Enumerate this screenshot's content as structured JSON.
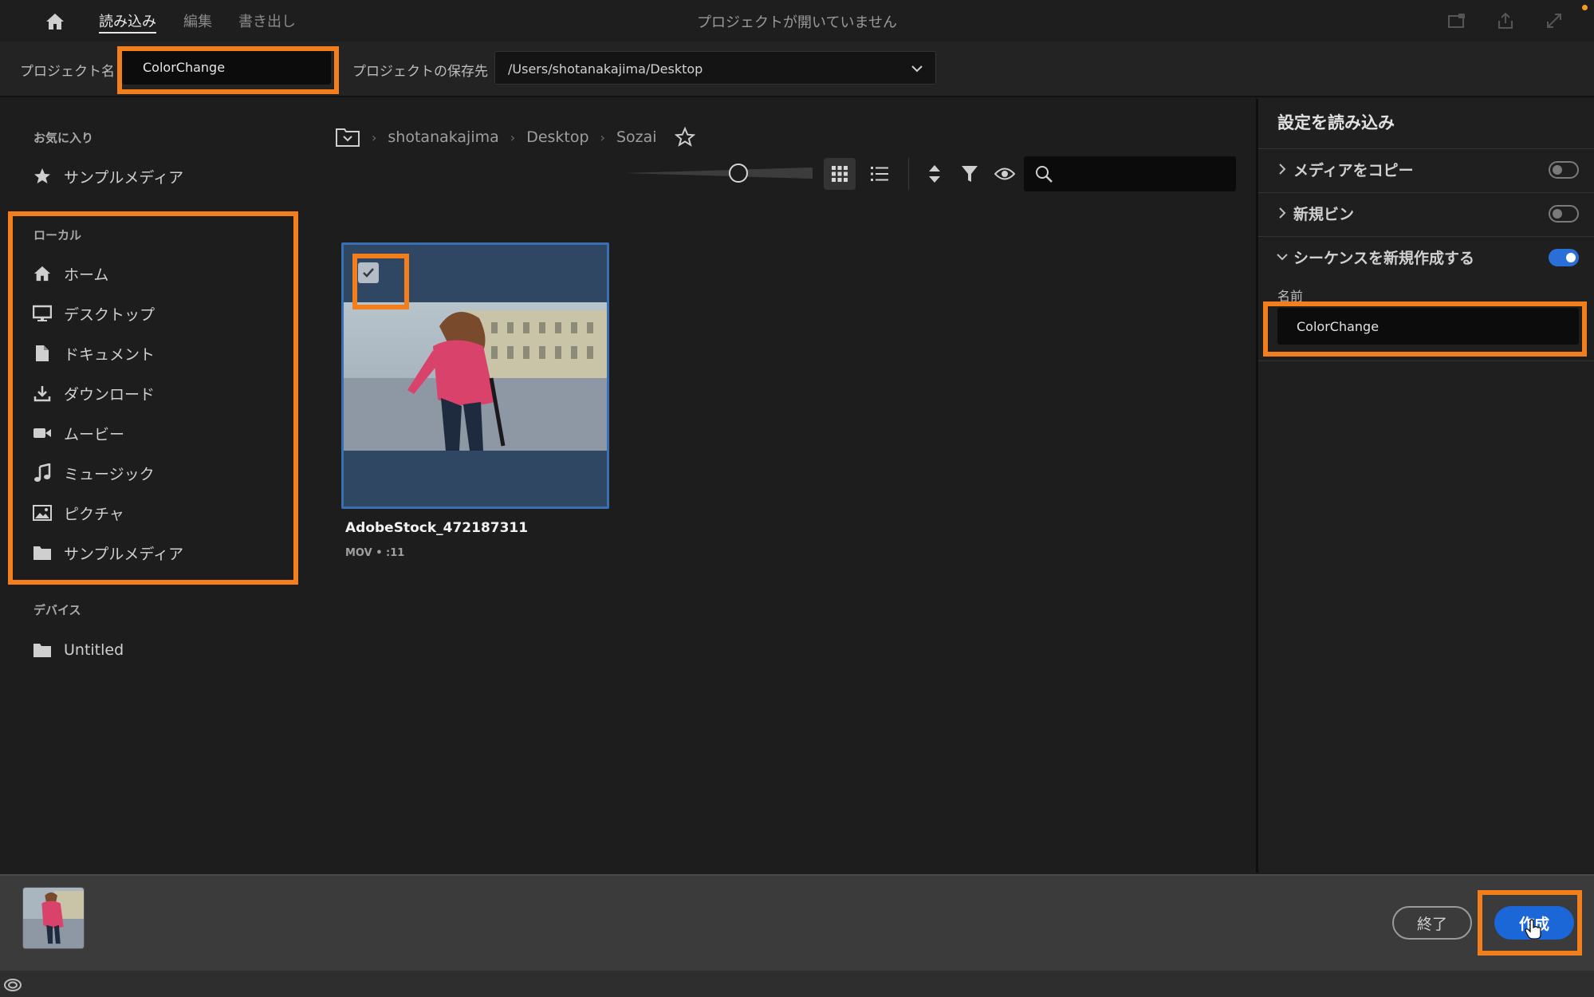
{
  "topbar": {
    "tabs": [
      {
        "label": "読み込み",
        "active": true
      },
      {
        "label": "編集",
        "active": false
      },
      {
        "label": "書き出し",
        "active": false
      }
    ],
    "title": "プロジェクトが開いていません",
    "icons": [
      "home-icon",
      "new-window-icon",
      "share-icon",
      "fullscreen-icon"
    ]
  },
  "project": {
    "name_label": "プロジェクト名",
    "name_value": "ColorChange",
    "location_label": "プロジェクトの保存先",
    "location_value": "/Users/shotanakajima/Desktop"
  },
  "sidebar": {
    "favorites_heading": "お気に入り",
    "favorites": [
      {
        "label": "サンプルメディア",
        "icon": "star-icon"
      }
    ],
    "local_heading": "ローカル",
    "local": [
      {
        "label": "ホーム",
        "icon": "home-icon"
      },
      {
        "label": "デスクトップ",
        "icon": "monitor-icon"
      },
      {
        "label": "ドキュメント",
        "icon": "document-icon"
      },
      {
        "label": "ダウンロード",
        "icon": "download-icon"
      },
      {
        "label": "ムービー",
        "icon": "video-camera-icon"
      },
      {
        "label": "ミュージック",
        "icon": "music-note-icon"
      },
      {
        "label": "ピクチャ",
        "icon": "image-icon"
      },
      {
        "label": "サンプルメディア",
        "icon": "folder-icon"
      }
    ],
    "devices_heading": "デバイス",
    "devices": [
      {
        "label": "Untitled",
        "icon": "folder-icon"
      }
    ]
  },
  "browser": {
    "breadcrumb": [
      "shotanakajima",
      "Desktop",
      "Sozai"
    ],
    "view_mode": "grid",
    "search_placeholder": "",
    "media": [
      {
        "name": "AdobeStock_472187311",
        "meta": "MOV • :11",
        "checked": true
      }
    ]
  },
  "settings": {
    "title": "設定を読み込み",
    "rows": [
      {
        "label": "メディアをコピー",
        "expanded": false,
        "enabled": false
      },
      {
        "label": "新規ビン",
        "expanded": false,
        "enabled": false
      },
      {
        "label": "シーケンスを新規作成する",
        "expanded": true,
        "enabled": true
      }
    ],
    "sequence_name_label": "名前",
    "sequence_name_value": "ColorChange"
  },
  "footer": {
    "quit_label": "終了",
    "create_label": "作成"
  },
  "colors": {
    "accent": "#1b67d8",
    "highlight": "#f27f1b",
    "selection": "#3b6fb3"
  }
}
